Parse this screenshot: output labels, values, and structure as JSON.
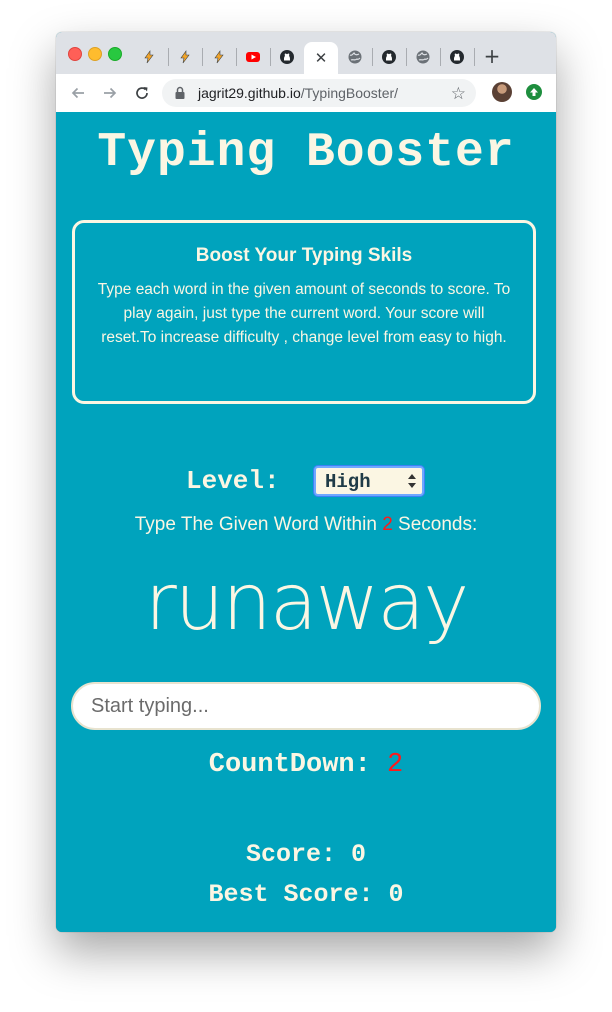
{
  "browser": {
    "tabs": [
      {
        "icon": "blogger-icon"
      },
      {
        "icon": "blogger-icon"
      },
      {
        "icon": "blogger-icon"
      },
      {
        "icon": "youtube-icon"
      },
      {
        "icon": "github-icon"
      },
      {
        "icon": "close-icon",
        "active": true
      },
      {
        "icon": "globe-icon"
      },
      {
        "icon": "github-icon"
      },
      {
        "icon": "globe-icon"
      },
      {
        "icon": "github-icon"
      }
    ],
    "close_glyph": "✕",
    "new_tab_glyph": "+",
    "url_host": "jagrit29.github.io",
    "url_path": "/TypingBooster/",
    "star_glyph": "☆"
  },
  "app": {
    "title": "Typing Booster",
    "info_title": "Boost Your Typing Skils",
    "info_text": "Type each word in the given amount of seconds to score. To play again, just type the current word. Your score will reset.To increase difficulty , change level from easy to high.",
    "level_label": "Level:",
    "level_value": "High",
    "instruction_before": "Type The Given Word Within ",
    "instruction_seconds": "2",
    "instruction_after": " Seconds:",
    "current_word": "runaway",
    "input_placeholder": "Start typing...",
    "countdown_label": "CountDown: ",
    "countdown_value": "2",
    "score_label": "Score: ",
    "score_value": "0",
    "best_label": "Best Score: ",
    "best_value": "0"
  },
  "colors": {
    "background": "#00a3bd",
    "text": "#fbf6e3",
    "accent_red": "#ff1a1a"
  }
}
